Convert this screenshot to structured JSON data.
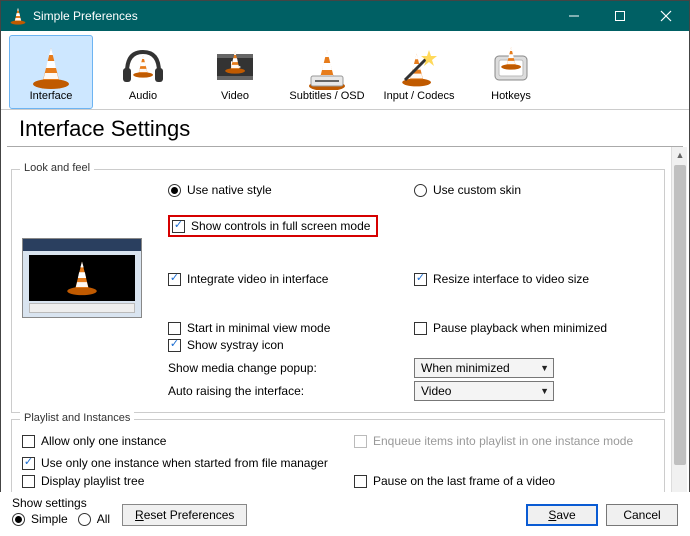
{
  "titlebar": {
    "title": "Simple Preferences"
  },
  "tabs": {
    "interface": "Interface",
    "audio": "Audio",
    "video": "Video",
    "subs": "Subtitles / OSD",
    "codecs": "Input / Codecs",
    "hotkeys": "Hotkeys"
  },
  "heading": "Interface Settings",
  "lookfeel": {
    "group_title": "Look and feel",
    "native_style": "Use native style",
    "custom_skin": "Use custom skin",
    "show_controls_fs": "Show controls in full screen mode",
    "integrate_video": "Integrate video in interface",
    "resize_to_video": "Resize interface to video size",
    "start_minimal": "Start in minimal view mode",
    "pause_minimized": "Pause playback when minimized",
    "show_systray": "Show systray icon",
    "media_popup_label": "Show media change popup:",
    "auto_raise_label": "Auto raising the interface:",
    "media_popup_value": "When minimized",
    "auto_raise_value": "Video"
  },
  "playlist": {
    "group_title": "Playlist and Instances",
    "allow_one": "Allow only one instance",
    "enqueue_one": "Enqueue items into playlist in one instance mode",
    "use_one_fm": "Use only one instance when started from file manager",
    "display_tree": "Display playlist tree",
    "pause_last_frame": "Pause on the last frame of a video"
  },
  "footer": {
    "show_settings_label": "Show settings",
    "simple": "Simple",
    "all": "All",
    "reset": "Reset Preferences",
    "save": "Save",
    "cancel": "Cancel"
  }
}
